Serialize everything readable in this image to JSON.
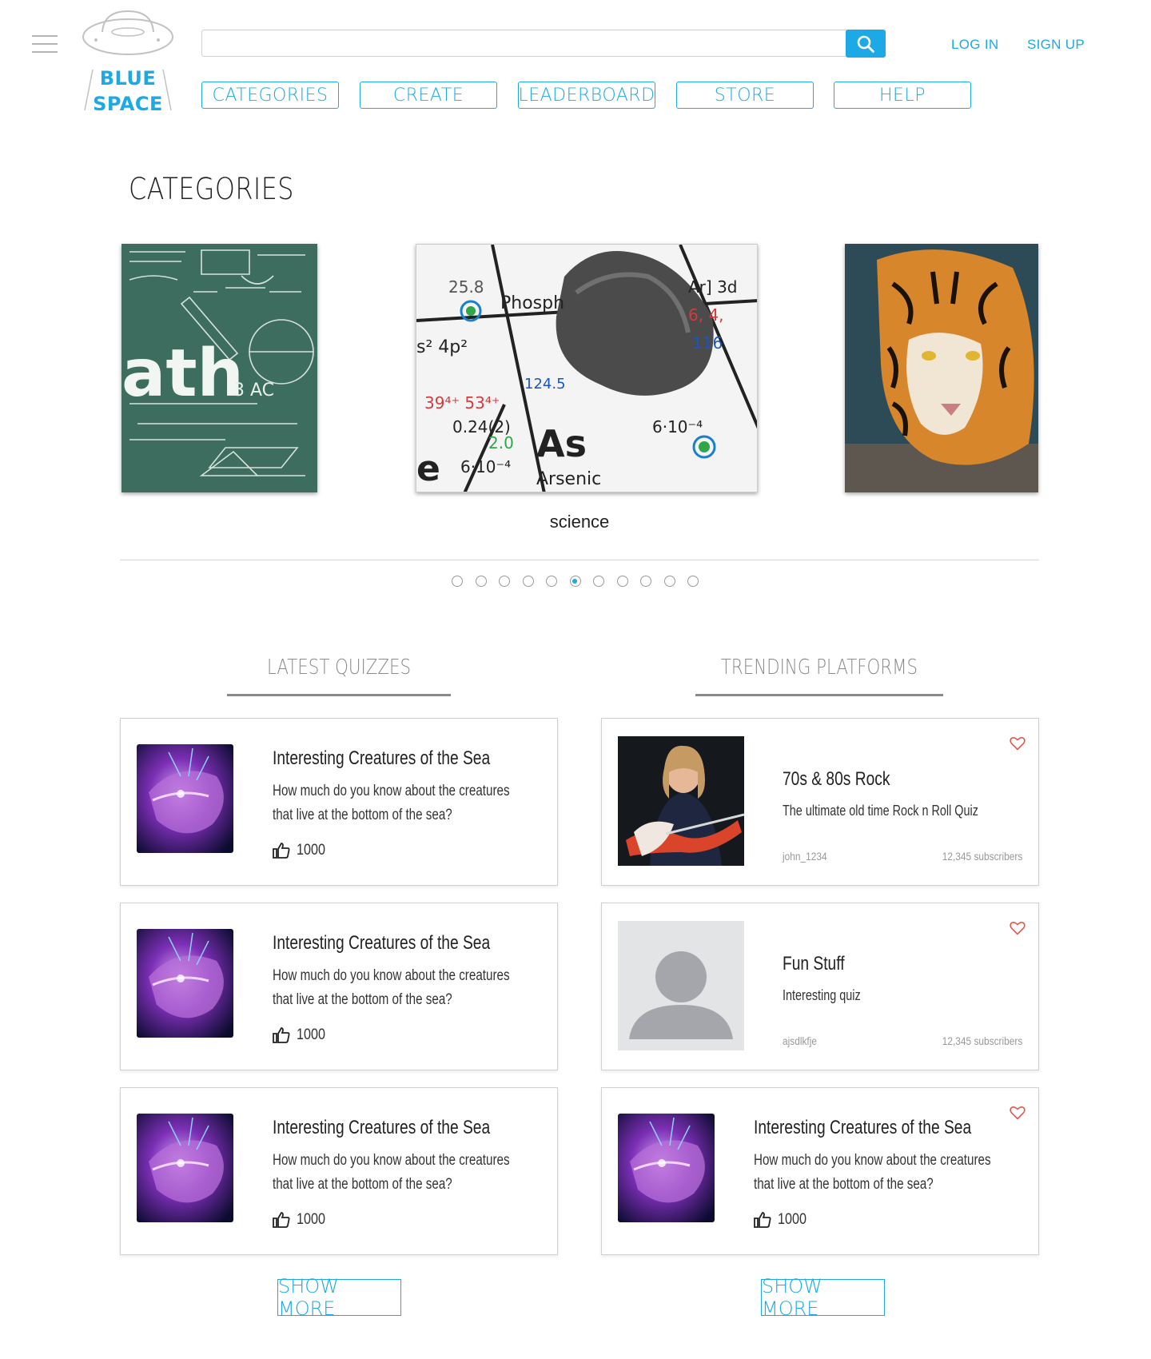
{
  "header": {
    "logo": {
      "line1": "BLUE",
      "line2": "SPACE"
    },
    "search": {
      "value": "",
      "placeholder": ""
    },
    "login": "LOG IN",
    "signup": "SIGN UP",
    "nav": [
      "CATEGORIES",
      "CREATE",
      "LEADERBOARD",
      "STORE",
      "HELP"
    ]
  },
  "categories": {
    "title": "CATEGORIES",
    "current_label": "science",
    "dot_count": 11,
    "active_dot": 5
  },
  "latest": {
    "title": "LATEST QUIZZES",
    "items": [
      {
        "title": "Interesting Creatures of the Sea",
        "desc": "How much do you know about the creatures that live at the bottom of the sea?",
        "likes": "1000"
      },
      {
        "title": "Interesting Creatures of the Sea",
        "desc": "How much do you know about the creatures that live at the bottom of the sea?",
        "likes": "1000"
      },
      {
        "title": "Interesting Creatures of the Sea",
        "desc": "How much do you know about the creatures that live at the bottom of the sea?",
        "likes": "1000"
      }
    ],
    "show_more": "SHOW MORE"
  },
  "trending": {
    "title": "TRENDING PLATFORMS",
    "items": [
      {
        "title": "70s & 80s Rock",
        "desc": "The ultimate old time Rock n Roll Quiz",
        "user": "john_1234",
        "subscribers": "12,345 subscribers"
      },
      {
        "title": "Fun Stuff",
        "desc": "Interesting quiz",
        "user": "ajsdlkfje",
        "subscribers": "12,345 subscribers"
      },
      {
        "title": "Interesting Creatures of the Sea",
        "desc": "How much do you know about the creatures that live at the bottom of the sea?",
        "likes": "1000"
      }
    ],
    "show_more": "SHOW MORE"
  },
  "colors": {
    "accent": "#1ca9e6",
    "heart": "#e2574c",
    "rule": "#8a8a8a"
  }
}
